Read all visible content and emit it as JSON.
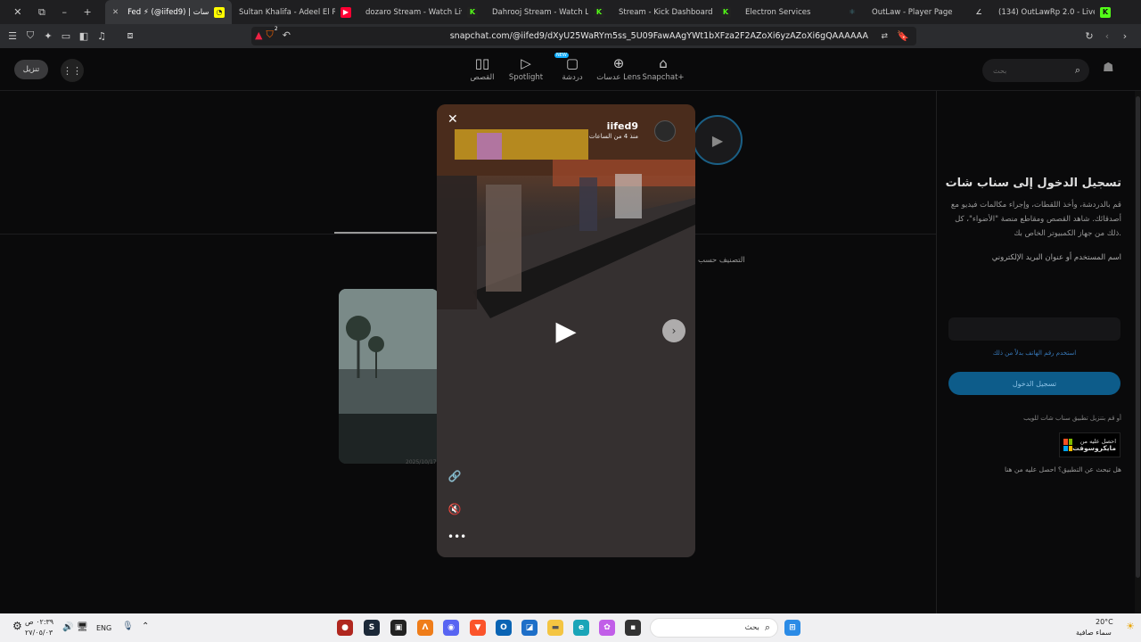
{
  "browser": {
    "tabs": [
      {
        "label": "Fed ⚡ (@iifed9) | عدسات",
        "icon": "snapchat-icon",
        "color": "#fffc00",
        "active": true
      },
      {
        "label": "Sultan Khalifa - Adeel El Rooh",
        "icon": "youtube-icon",
        "color": "#ff0033"
      },
      {
        "label": "dozaro Stream - Watch Live on",
        "icon": "kick-icon",
        "color": "#53fc18"
      },
      {
        "label": "Dahrooj Stream - Watch Live o",
        "icon": "kick-icon",
        "color": "#53fc18"
      },
      {
        "label": "Stream - Kick Dashboard",
        "icon": "kick-icon",
        "color": "#53fc18"
      },
      {
        "label": "Electron Services",
        "icon": "electron-icon",
        "color": "#47848f"
      },
      {
        "label": "OutLaw - Player Page",
        "icon": "outlaw-icon",
        "color": "#cccccc"
      },
      {
        "label": "(134) OutLawRp 2.0 - Live Com",
        "icon": "kick-icon",
        "color": "#53fc18"
      }
    ],
    "url": "snapchat.com/@iifed9/dXyU25WaRYm5ss_5U09FawAAgYWt1bXFza2F2AZoXi6yzAZoXi6gQAAAAAA",
    "shield_count": "2"
  },
  "snap": {
    "download_label": "تنزيل",
    "nav": [
      {
        "label": "القصص",
        "icon": "stories-icon"
      },
      {
        "label": "Spotlight",
        "icon": "spotlight-icon"
      },
      {
        "label": "دردشة",
        "icon": "chat-icon",
        "badge": "NEW"
      },
      {
        "label": "عدسات Lens",
        "icon": "lens-icon"
      },
      {
        "label": "Snapchat+",
        "icon": "ghost-icon"
      }
    ],
    "search_placeholder": "بحث",
    "sort_label": "التصنيف حسب",
    "card_date": "2025/10/17"
  },
  "player": {
    "username": "iifed9",
    "time": "منذ 4 من الساعات"
  },
  "login": {
    "title": "تسجيل الدخول إلى سناب شات",
    "desc": "قم بالدردشة، وأخذ اللقطات، وإجراء مكالمات فيديو مع أصدقائك. شاهد القصص ومقاطع منصة \"الأضواء\"، كل ذلك من جهاز الكمبيوتر الخاص بك.",
    "field_label": "اسم المستخدم أو عنوان البريد الإلكتروني",
    "phone_link": "استخدم رقم الهاتف بدلاً من ذلك",
    "button": "تسجيل الدخول",
    "or_download": "أو قم بتنزيل تطبيق سناب شات للويب",
    "ms_line1": "احصل عليه من",
    "ms_line2": "مايكروسوفت",
    "help": "هل تبحث عن التطبيق؟ احصل عليه من هنا"
  },
  "taskbar": {
    "clock": "٠٢:٣٩ ص",
    "date": "٢٧/٠٥/٠٣",
    "lang": "ENG",
    "search": "بحث",
    "temp": "20°C",
    "weather": "سماء صافية"
  }
}
